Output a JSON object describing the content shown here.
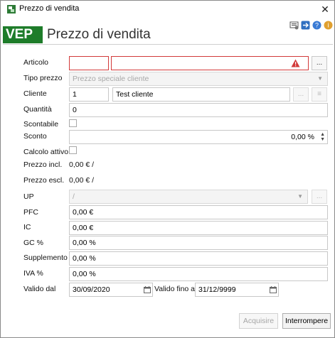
{
  "window": {
    "title": "Prezzo di vendita"
  },
  "header": {
    "badge": "VEP",
    "title": "Prezzo di vendita"
  },
  "toolbar_icons": [
    "settings-icon",
    "export-icon",
    "help-icon",
    "info-icon"
  ],
  "form": {
    "articolo": {
      "label": "Articolo",
      "code": "",
      "name": "",
      "browse": "..."
    },
    "tipo_prezzo": {
      "label": "Tipo prezzo",
      "value": "Prezzo speciale cliente"
    },
    "cliente": {
      "label": "Cliente",
      "code": "1",
      "name": "Test cliente",
      "browse": "...",
      "extra": "≡"
    },
    "quantita": {
      "label": "Quantità",
      "value": "0"
    },
    "scontabile": {
      "label": "Scontabile"
    },
    "sconto": {
      "label": "Sconto",
      "value": "0,00 %"
    },
    "calcolo_attivo": {
      "label": "Calcolo attivo"
    },
    "prezzo_incl": {
      "label": "Prezzo incl.",
      "value": "0,00 €  /"
    },
    "prezzo_escl": {
      "label": "Prezzo escl.",
      "value": "0,00 €  /"
    },
    "up": {
      "label": "UP",
      "value": "/"
    },
    "pfc": {
      "label": "PFC",
      "value": "0,00 €"
    },
    "ic": {
      "label": "IC",
      "value": "0,00 €"
    },
    "gc": {
      "label": "GC %",
      "value": "0,00 %"
    },
    "supplemento": {
      "label": "Supplemento %",
      "value": "0,00 %"
    },
    "iva": {
      "label": "IVA %",
      "value": "0,00 %"
    },
    "valido_dal": {
      "label": "Valido dal",
      "value": "30/09/2020"
    },
    "valido_fino": {
      "label": "Valido fino al",
      "value": "31/12/9999"
    }
  },
  "buttons": {
    "acquisire": "Acquisire",
    "interrompere": "Interrompere"
  },
  "colors": {
    "brand_green": "#1e7c2a",
    "error_red": "#d23a3a"
  }
}
